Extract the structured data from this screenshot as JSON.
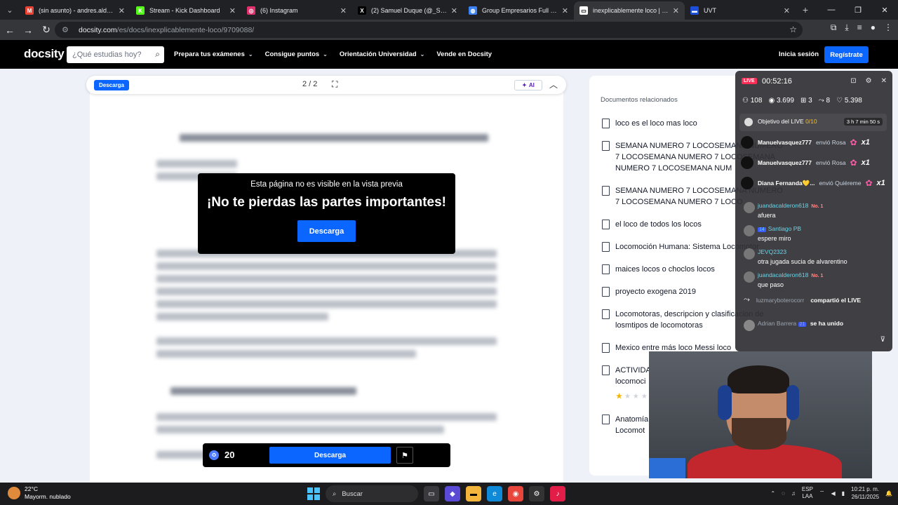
{
  "browser": {
    "tabs": [
      {
        "label": "(sin asunto) - andres.aldana071",
        "icon": "gmail-icon",
        "color": "#ea4335",
        "glyph": "M"
      },
      {
        "label": "Stream - Kick Dashboard",
        "icon": "kick-icon",
        "color": "#53fc18",
        "glyph": "K"
      },
      {
        "label": "(6) Instagram",
        "icon": "instagram-icon",
        "color": "#e1306c",
        "glyph": "◎"
      },
      {
        "label": "(2) Samuel Duque (@_SamuelD",
        "icon": "x-icon",
        "color": "#000000",
        "glyph": "X"
      },
      {
        "label": "Group Empresarios Full CJ Colo",
        "icon": "globe-icon",
        "color": "#3b82f6",
        "glyph": "◍"
      },
      {
        "label": "inexplicablemente loco | Resúm",
        "icon": "docsity-icon",
        "color": "#ffffff",
        "glyph": "▭"
      },
      {
        "label": "UVT",
        "icon": "uvt-icon",
        "color": "#1d4ed8",
        "glyph": "▬"
      }
    ],
    "active_tab": 5,
    "url_host": "docsity.com",
    "url_path": "/es/docs/inexplicablemente-loco/9709088/"
  },
  "docsity": {
    "logo": "docsity",
    "search_placeholder": "¿Qué estudias hoy?",
    "menu": [
      "Prepara tus exámenes",
      "Consigue puntos",
      "Orientación Universidad",
      "Vende en Docsity"
    ],
    "login": "Inicia sesión",
    "register": "Regístrate",
    "toolbar": {
      "download": "Descarga",
      "page": "2 / 2",
      "ai": "AI"
    },
    "overlay": {
      "small": "Esta página no es visible en la vista previa",
      "big": "¡No te pierdas las partes importantes!",
      "button": "Descarga"
    },
    "bottom": {
      "points": "20",
      "download": "Descarga"
    },
    "related_title": "Documentos relacionados",
    "related": [
      "loco es el loco mas loco",
      "SEMANA NUMERO 7 LOCOSEMANA NUMERO 7 LOCOSEMANA NUMERO 7 LOCOSEMANA NUMERO 7 LOCOSEMANA NUM",
      "SEMANA NUMERO 7 LOCOSEMANA NUMERO 7 LOCOSEMANA NUMERO 7 LOCO",
      "el loco de todos los locos",
      "Locomoción Humana: Sistema Locomotor",
      "maices locos o choclos locos",
      "proyecto exogena 2019",
      "Locomotoras, descripcion y clasificacion de losmtipos de locomotoras",
      "Mexico entre más loco Messi loco",
      "ACTIVIDAD locomoci",
      "Anatomía Locomot"
    ]
  },
  "live": {
    "badge": "LIVE",
    "time": "00:52:16",
    "stats": {
      "users": "108",
      "views": "3.699",
      "gifts": "3",
      "shares": "8",
      "likes": "5.398"
    },
    "goal_label": "Objetivo del LIVE",
    "goal_value": "0/10",
    "goal_time": "3 h 7 min 50 s",
    "gifts": [
      {
        "user": "Manuelvasquez777",
        "action": "envió Rosa",
        "count": "x1"
      },
      {
        "user": "Manuelvasquez777",
        "action": "envió Rosa",
        "count": "x1"
      },
      {
        "user": "Diana Fernanda💛...",
        "action": "envió Quiéreme",
        "count": "x1"
      }
    ],
    "messages": [
      {
        "user": "juandacalderon618",
        "badge": "No. 1",
        "text": "afuera"
      },
      {
        "user": "Santiago PB",
        "badge": "14",
        "text": "espere miro"
      },
      {
        "user": "JEVQ2323",
        "badge": "",
        "text": "otra jugada sucia de alvarentino"
      },
      {
        "user": "juandacalderon618",
        "badge": "No. 1",
        "text": "que paso"
      }
    ],
    "share_user": "luzmaryboterocorr",
    "share_text": "compartió el LIVE",
    "joined_user": "Adrian Barrera",
    "joined_badge": "21",
    "joined_text": "se ha unido"
  },
  "taskbar": {
    "temp": "22°C",
    "weather": "Mayorm. nublado",
    "search": "Buscar",
    "lang1": "ESP",
    "lang2": "LAA",
    "time": "10:21 p. m.",
    "date": "26/11/2025"
  }
}
